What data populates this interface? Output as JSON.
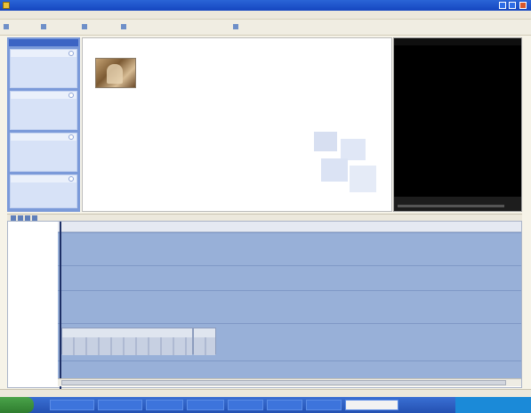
{
  "window": {
    "title": ""
  },
  "menu": {
    "items": [
      "",
      "",
      "",
      "",
      "",
      "",
      ""
    ]
  },
  "toolbar": {
    "items": [
      "",
      "",
      "",
      "",
      ""
    ]
  },
  "taskpane": {
    "header": "",
    "sections": [
      {
        "title": "",
        "links": [
          "",
          "",
          "",
          "",
          ""
        ]
      },
      {
        "title": "",
        "links": [
          "",
          "",
          "",
          "",
          ""
        ]
      },
      {
        "title": "",
        "links": [
          "",
          "",
          "",
          "",
          ""
        ]
      },
      {
        "title": "",
        "links": [
          "",
          "",
          "",
          ""
        ]
      }
    ]
  },
  "collection": {
    "breadcrumb": "",
    "subtitle": "",
    "clip_label": ""
  },
  "monitor": {
    "title": "",
    "time": "",
    "ratio": ""
  },
  "timeline": {
    "toolbar_label": "",
    "ruler_ticks": [
      "",
      "",
      "",
      "",
      "",
      "",
      "",
      "",
      "",
      "",
      ""
    ],
    "tracks": [
      "",
      "",
      "",
      "",
      ""
    ],
    "clips": [
      {
        "name": ""
      },
      {
        "name": ""
      }
    ]
  },
  "status": {
    "text": ""
  },
  "taskbar": {
    "start_label": "",
    "tasks": [
      "",
      "",
      "",
      "",
      "",
      "",
      "",
      ""
    ],
    "clock": ""
  }
}
